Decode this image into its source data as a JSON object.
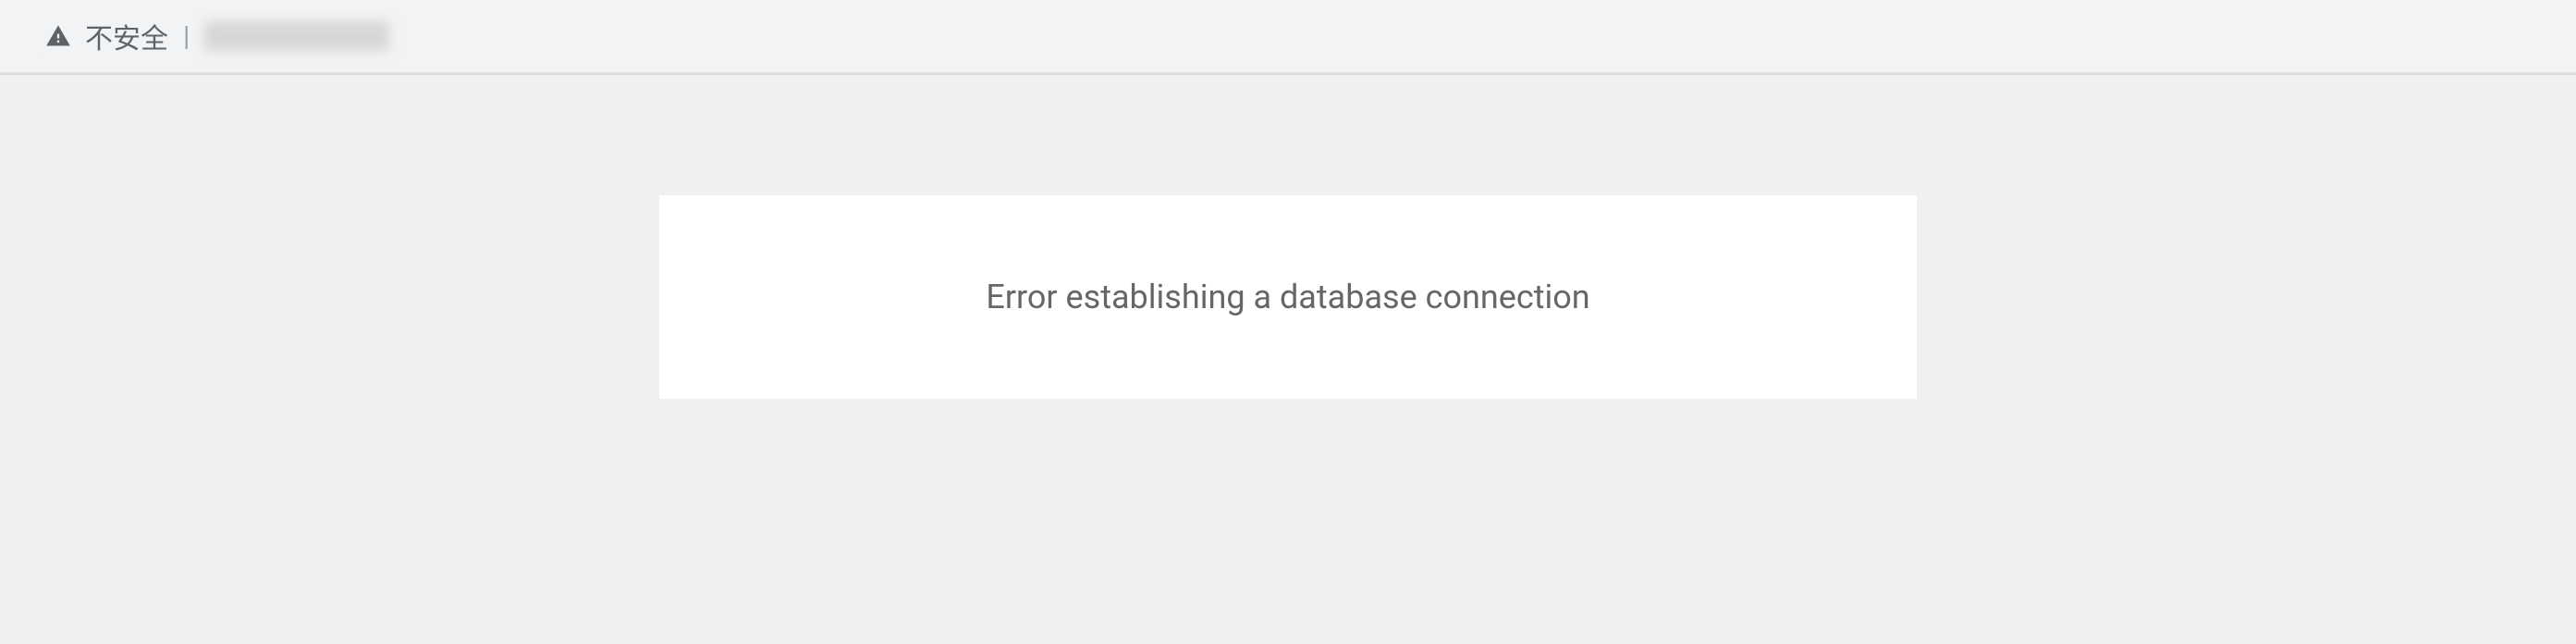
{
  "address_bar": {
    "security_label": "不安全",
    "separator": "|"
  },
  "page": {
    "error_message": "Error establishing a database connection"
  }
}
